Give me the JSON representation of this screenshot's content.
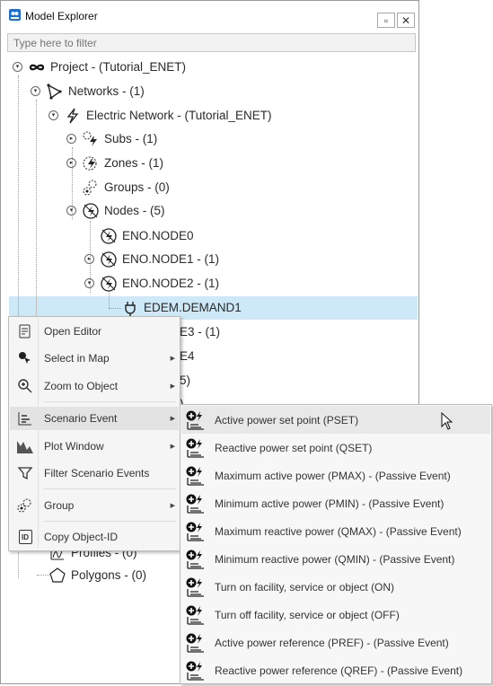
{
  "window": {
    "title": "Model Explorer",
    "restore_glyph": "▫",
    "close_glyph": "✕"
  },
  "filter": {
    "placeholder": "Type here to filter"
  },
  "tree": {
    "project": "Project - (Tutorial_ENET)",
    "networks": "Networks - (1)",
    "electric_network": "Electric Network - (Tutorial_ENET)",
    "subs": "Subs - (1)",
    "zones": "Zones - (1)",
    "groups": "Groups - (0)",
    "nodes": "Nodes - (5)",
    "node0": "ENO.NODE0",
    "node1": "ENO.NODE1 - (1)",
    "node2": "ENO.NODE2 - (1)",
    "demand1": "EDEM.DEMAND1",
    "node3_partial": "E3 - (1)",
    "node4_partial": "E4",
    "partial_a": "5)",
    "partial_b": ")",
    "profiles_partial": "Profiles - (0)",
    "polygons": "Polygons - (0)"
  },
  "context_menu": {
    "items": [
      {
        "label": "Open Editor",
        "icon": "editor-icon"
      },
      {
        "label": "Select in Map",
        "icon": "select-map-icon"
      },
      {
        "label": "Zoom to Object",
        "icon": "zoom-icon"
      },
      {
        "label": "Scenario Event",
        "icon": "scenario-event-icon"
      },
      {
        "label": "Plot Window",
        "icon": "plot-window-icon"
      },
      {
        "label": "Filter Scenario Events",
        "icon": "filter-icon"
      },
      {
        "label": "Group",
        "icon": "group-icon"
      },
      {
        "label": "Copy Object-ID",
        "icon": "copy-id-icon"
      }
    ],
    "copy_id_badge": "ID"
  },
  "submenu": {
    "items": [
      "Active power set point (PSET)",
      "Reactive power set point (QSET)",
      "Maximum active power (PMAX) - (Passive Event)",
      "Minimum active power (PMIN) - (Passive Event)",
      "Maximum reactive power (QMAX) - (Passive Event)",
      "Minimum reactive power (QMIN) - (Passive Event)",
      "Turn on facility, service or object (ON)",
      "Turn off facility, service or object (OFF)",
      "Active power reference (PREF) - (Passive Event)",
      "Reactive power reference (QREF) - (Passive Event)"
    ]
  },
  "colors": {
    "selection": "#cde8f6",
    "menu_bg": "#f5f5f5",
    "accent_blue": "#1f6fd1"
  }
}
